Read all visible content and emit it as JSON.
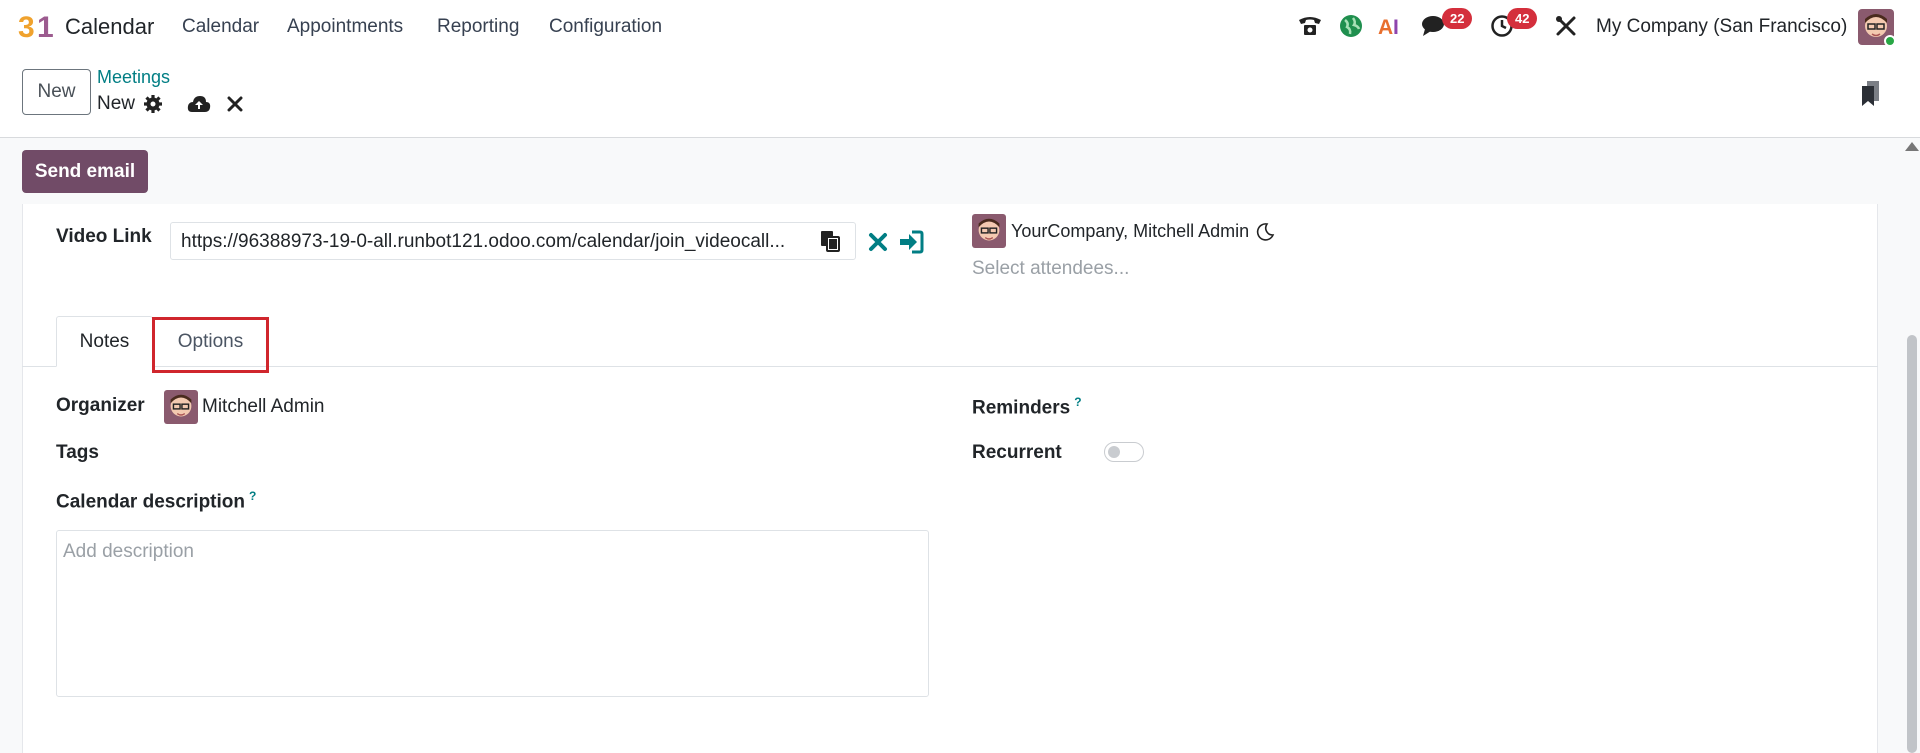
{
  "app": {
    "name": "Calendar",
    "logo_text": "31"
  },
  "menu": [
    "Calendar",
    "Appointments",
    "Reporting",
    "Configuration"
  ],
  "systray": {
    "discuss_count": "22",
    "activity_count": "42",
    "company": "My Company (San Francisco)"
  },
  "control": {
    "new_label": "New",
    "breadcrumb_parent": "Meetings",
    "record_name": "New"
  },
  "statusbar": {
    "send_email_label": "Send email"
  },
  "form": {
    "video_link_label": "Video Link",
    "video_link_value": "https://96388973-19-0-all.runbot121.odoo.com/calendar/join_videocall...",
    "attendees_text": "YourCompany, Mitchell Admin",
    "attendees_placeholder": "Select attendees...",
    "tabs": [
      {
        "label": "Notes"
      },
      {
        "label": "Options"
      }
    ],
    "organizer_label": "Organizer",
    "organizer_value": "Mitchell Admin",
    "tags_label": "Tags",
    "calendar_description_label": "Calendar description",
    "description_placeholder": "Add description",
    "reminders_label": "Reminders",
    "recurrent_label": "Recurrent",
    "help_mark": "?"
  },
  "colors": {
    "brand": "#714b67",
    "accent": "#017e84",
    "badge": "#d42f3c",
    "highlight": "#d0262d"
  },
  "icons": [
    "phone-icon",
    "website-icon",
    "ai-icon",
    "chat-icon",
    "clock-icon",
    "tools-icon",
    "gear-icon",
    "cloud-upload-icon",
    "discard-icon",
    "copy-icon",
    "clear-icon",
    "join-icon",
    "moon-icon",
    "bookmark-icon"
  ]
}
